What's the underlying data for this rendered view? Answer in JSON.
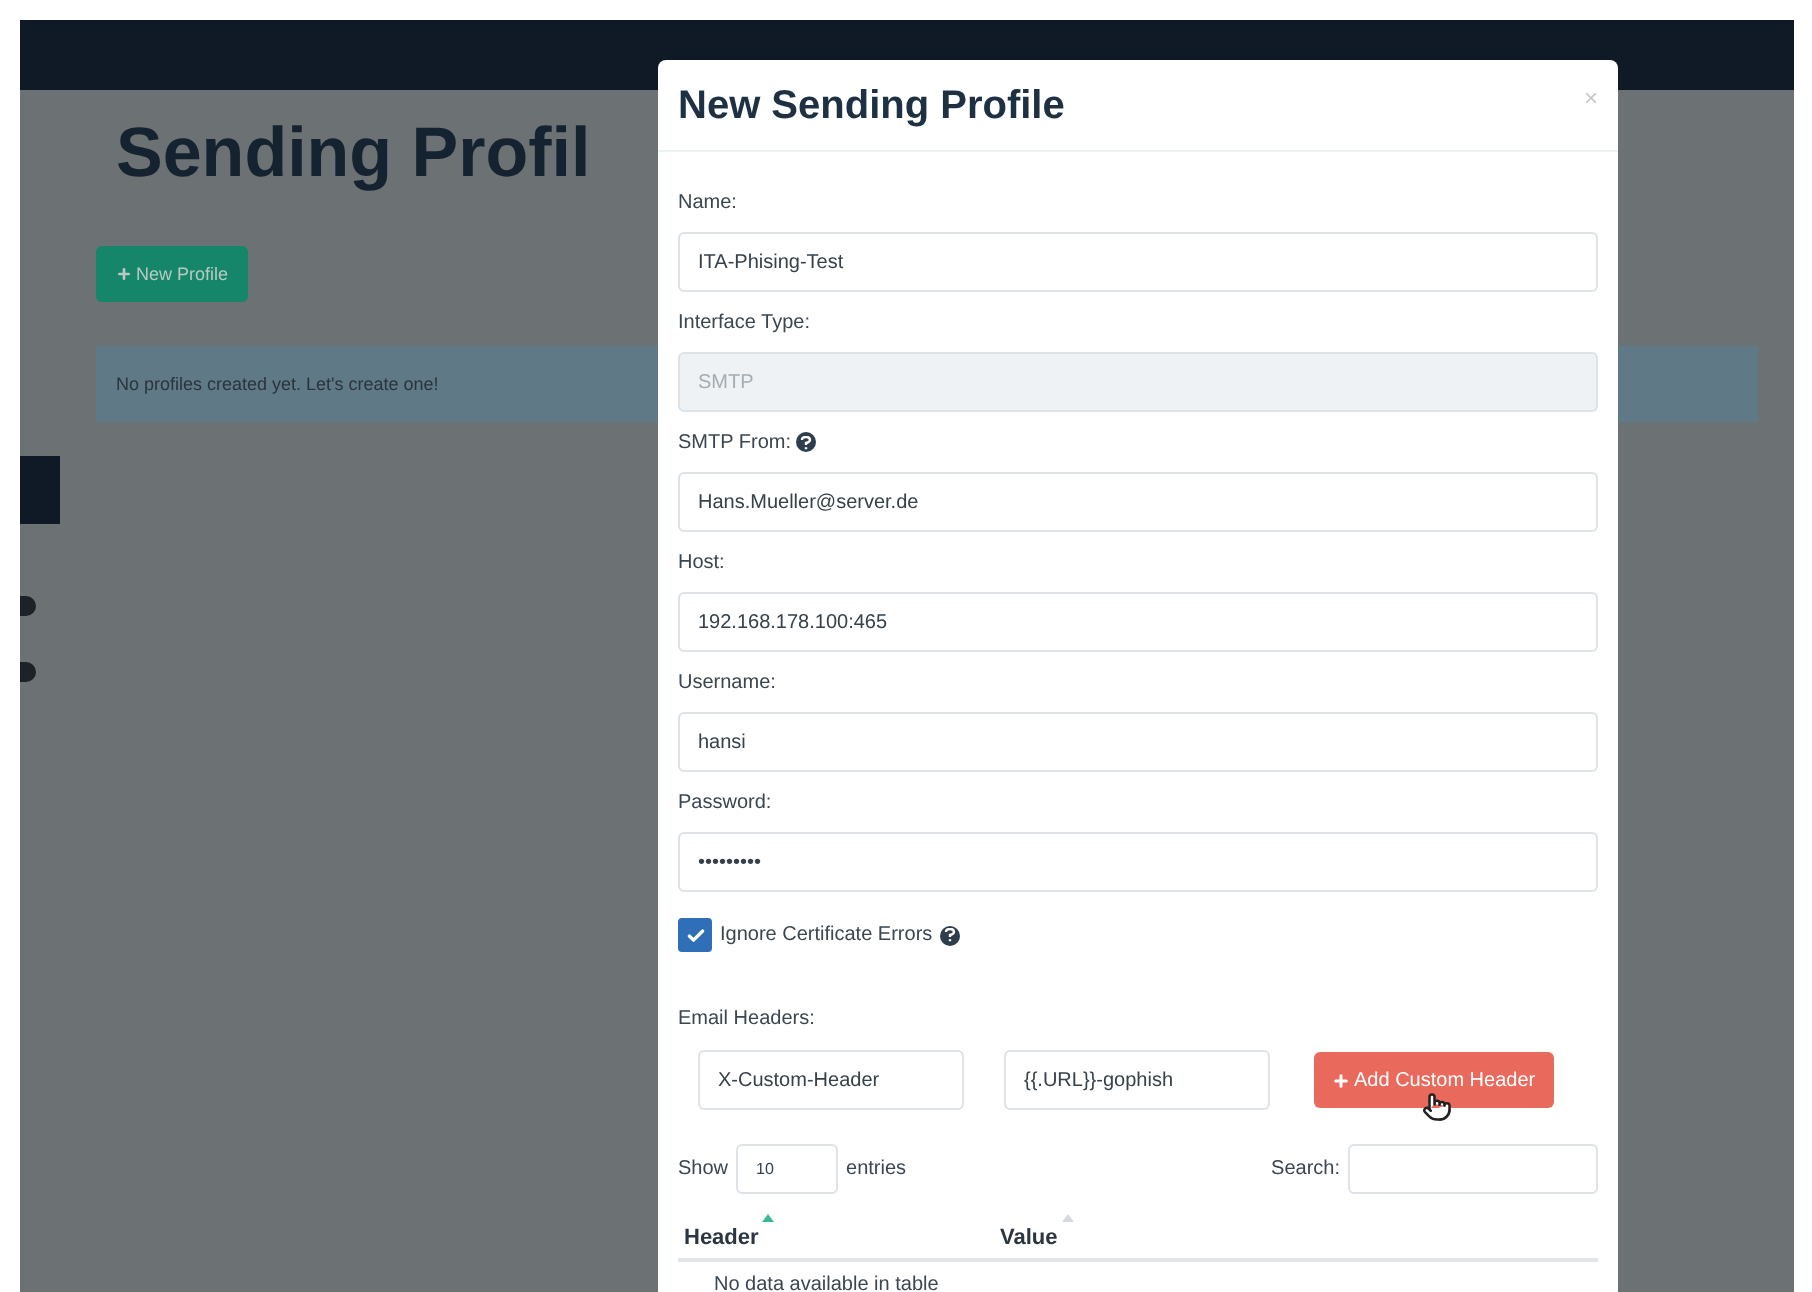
{
  "page": {
    "title": "Sending Profil",
    "new_button": "New Profile",
    "alert": "No profiles created yet. Let's create one!"
  },
  "modal": {
    "title": "New Sending Profile",
    "close": "×",
    "fields": [
      {
        "label": "Name:",
        "value": "ITA-Phising-Test",
        "disabled": false,
        "help": false
      },
      {
        "label": "Interface Type:",
        "value": "SMTP",
        "disabled": true,
        "help": false
      },
      {
        "label": "SMTP From:",
        "value": "Hans.Mueller@server.de",
        "disabled": false,
        "help": true
      },
      {
        "label": "Host:",
        "value": "192.168.178.100:465",
        "disabled": false,
        "help": false
      },
      {
        "label": "Username:",
        "value": "hansi",
        "disabled": false,
        "help": false
      },
      {
        "label": "Password:",
        "value": "•••••••••",
        "disabled": false,
        "help": false
      }
    ],
    "ignore_cert": {
      "label": "Ignore Certificate Errors",
      "checked": true
    },
    "headers": {
      "label": "Email Headers:",
      "header_value": "X-Custom-Header",
      "value_value": "{{.URL}}-gophish",
      "add_button": "Add Custom Header"
    },
    "table": {
      "show": "Show",
      "length": "10",
      "entries": "entries",
      "search": "Search:",
      "columns": [
        {
          "label": "Header",
          "sorted": true
        },
        {
          "label": "Value",
          "sorted": false
        }
      ],
      "empty": "No data available in table"
    }
  }
}
